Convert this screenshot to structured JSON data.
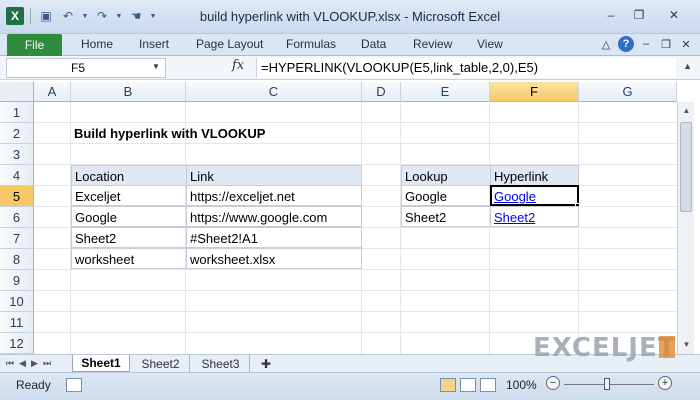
{
  "window": {
    "title": "build hyperlink with VLOOKUP.xlsx - Microsoft Excel",
    "minimize": "–",
    "restore": "❐",
    "close": "✕"
  },
  "ribbon": {
    "file": "File",
    "tabs": [
      "Home",
      "Insert",
      "Page Layout",
      "Formulas",
      "Data",
      "Review",
      "View"
    ]
  },
  "formula_bar": {
    "name_box": "F5",
    "fx": "fx",
    "formula": "=HYPERLINK(VLOOKUP(E5,link_table,2,0),E5)"
  },
  "columns": [
    "A",
    "B",
    "C",
    "D",
    "E",
    "F",
    "G"
  ],
  "selected_column": "F",
  "rows": [
    "1",
    "2",
    "3",
    "4",
    "5",
    "6",
    "7",
    "8",
    "9",
    "10",
    "11",
    "12"
  ],
  "selected_row": "5",
  "sheet_title": "Build hyperlink with VLOOKUP",
  "link_table": {
    "headers": [
      "Location",
      "Link"
    ],
    "rows": [
      [
        "Exceljet",
        "https://exceljet.net"
      ],
      [
        "Google",
        "https://www.google.com"
      ],
      [
        "Sheet2",
        "#Sheet2!A1"
      ],
      [
        "worksheet",
        "worksheet.xlsx"
      ]
    ]
  },
  "lookup_table": {
    "headers": [
      "Lookup",
      "Hyperlink"
    ],
    "rows": [
      [
        "Google",
        "Google"
      ],
      [
        "Sheet2",
        "Sheet2"
      ]
    ]
  },
  "sheets": [
    "Sheet1",
    "Sheet2",
    "Sheet3"
  ],
  "active_sheet": "Sheet1",
  "status": {
    "ready": "Ready",
    "zoom": "100%",
    "zoom_fraction": 0.5
  },
  "brand": "EXCELJET"
}
